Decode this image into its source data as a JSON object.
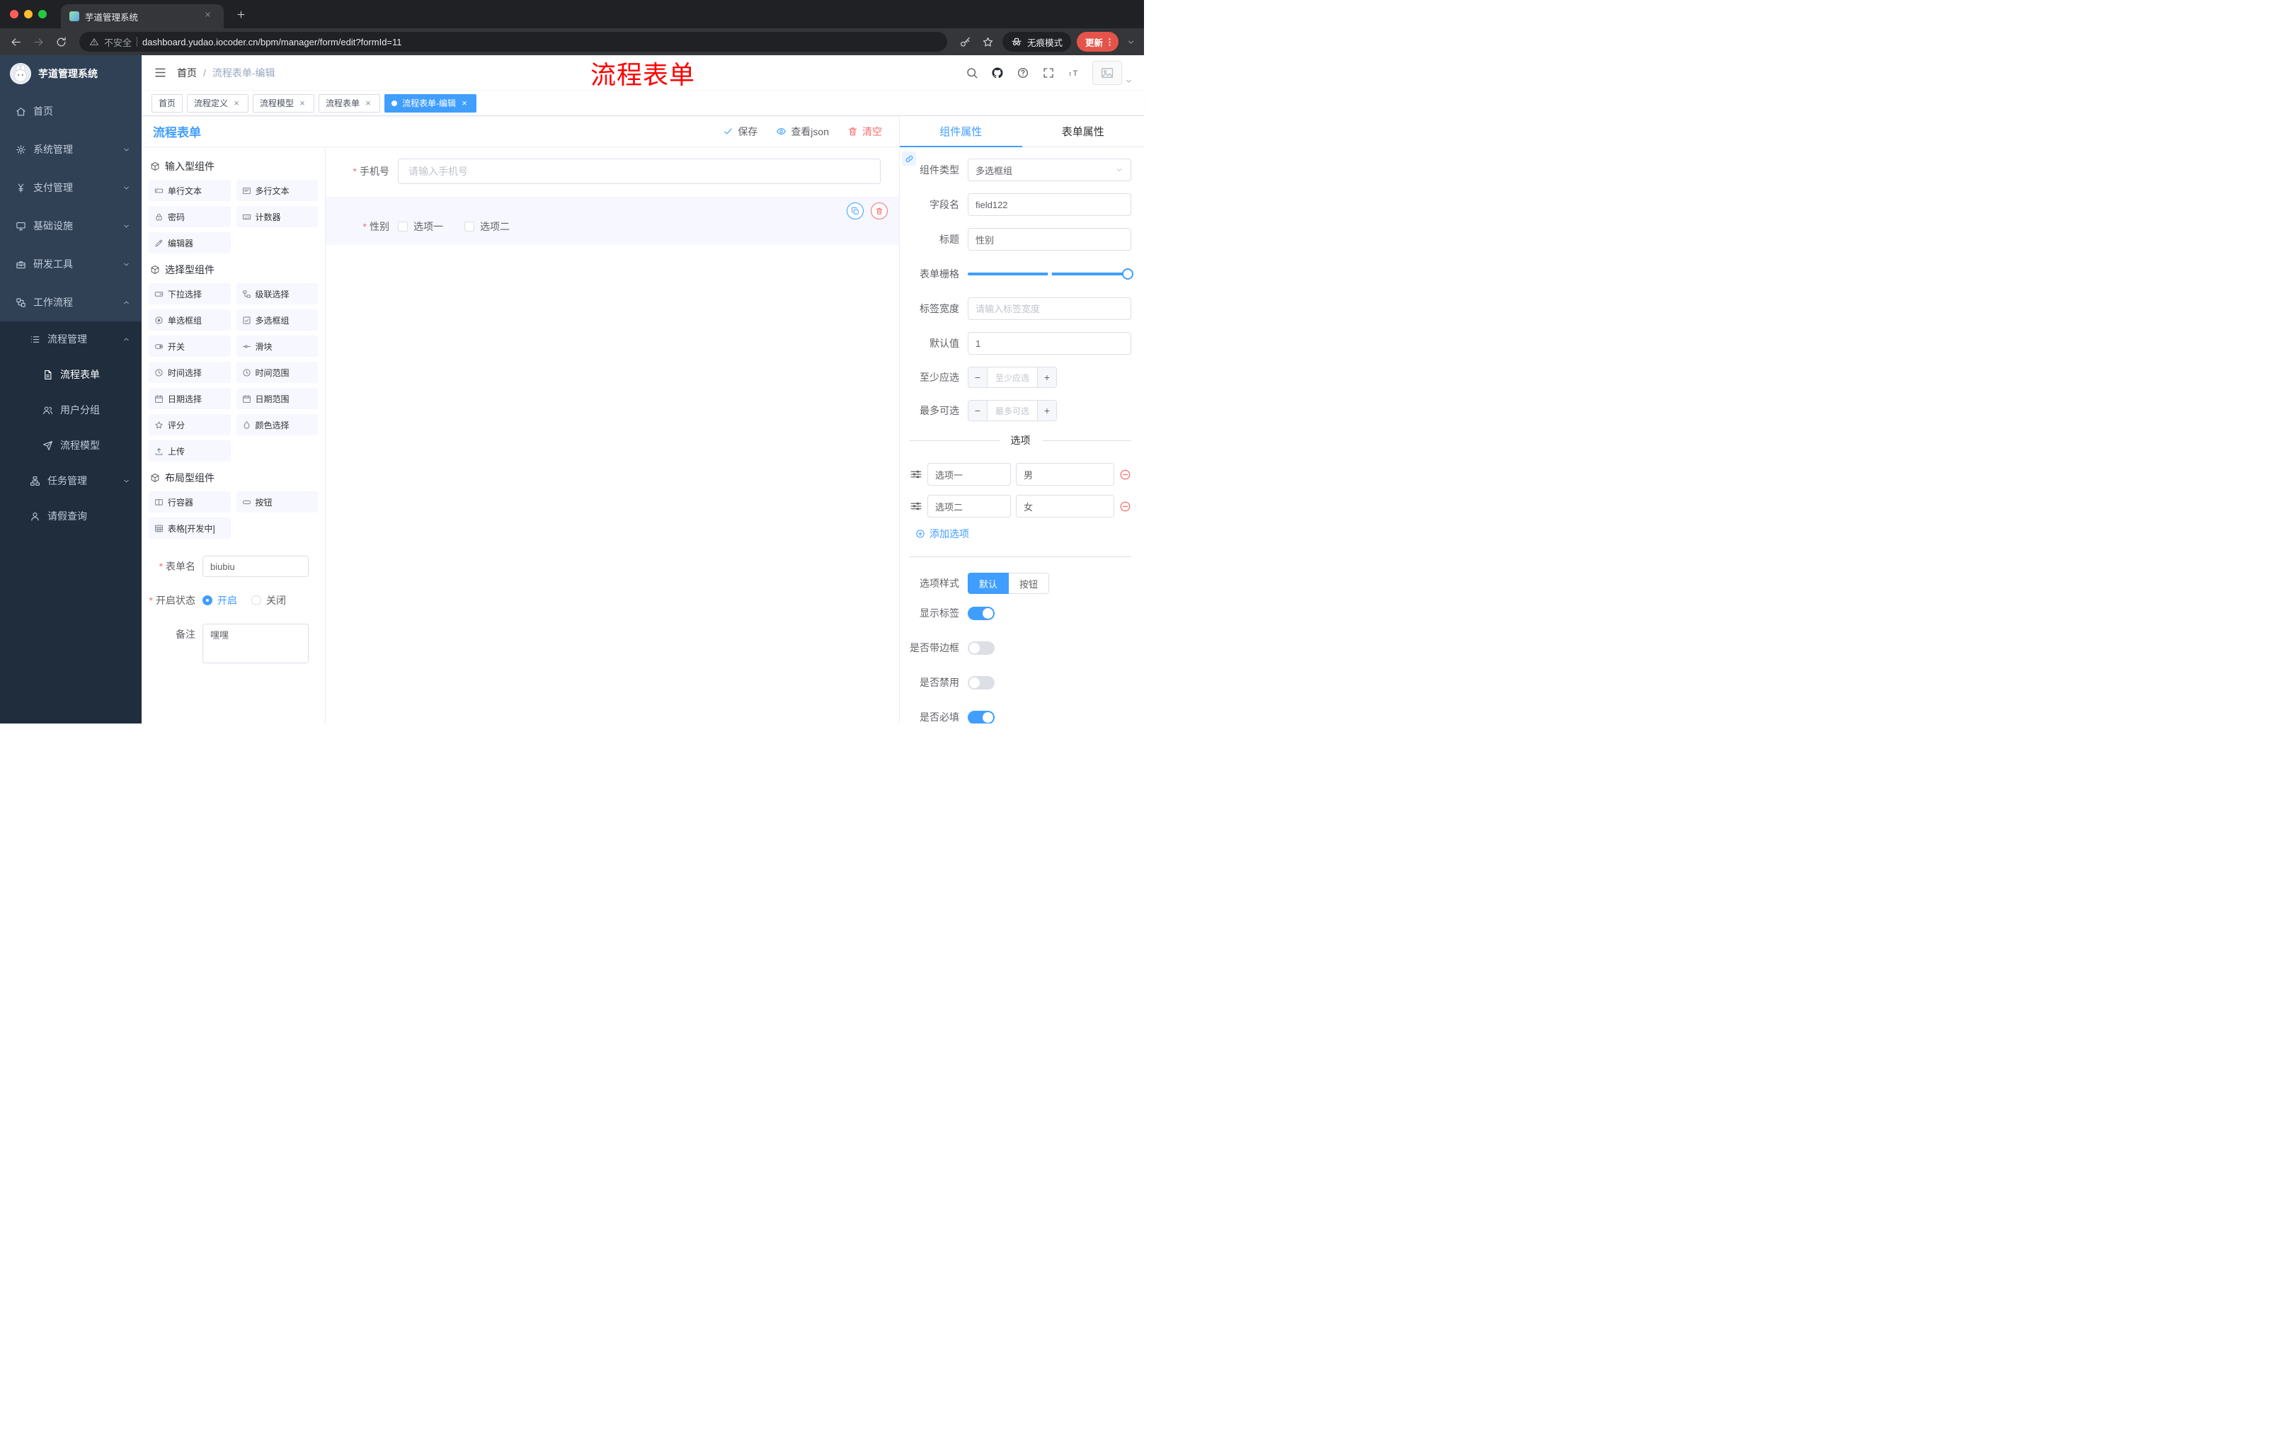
{
  "colors": {
    "primary": "#409eff",
    "danger": "#f56c6c",
    "annotation_red": "#ff0000",
    "sidebar_bg": "#304156",
    "sidebar_submenu_bg": "#1f2d3d",
    "active_tag": "#409eff",
    "update_pill": "#e5544b",
    "selected_field_bg": "#f6f7ff"
  },
  "browser": {
    "tab_title": "芋道管理系统",
    "security": "不安全",
    "url": "dashboard.yudao.iocoder.cn/bpm/manager/form/edit?formId=11",
    "incognito": "无痕模式",
    "update": "更新"
  },
  "sidebar": {
    "logo": "芋道管理系统",
    "menu": [
      "首页",
      "系统管理",
      "支付管理",
      "基础设施",
      "研发工具",
      "工作流程",
      "流程管理",
      "流程表单",
      "用户分组",
      "流程模型",
      "任务管理",
      "请假查询"
    ]
  },
  "header": {
    "breadcrumb_home": "首页",
    "breadcrumb_separator": "/",
    "breadcrumb_current": "流程表单-编辑",
    "annotation": "流程表单"
  },
  "tags": [
    "首页",
    "流程定义",
    "流程模型",
    "流程表单",
    "流程表单-编辑"
  ],
  "designer": {
    "title": "流程表单",
    "actions": {
      "save": "保存",
      "view_json": "查看json",
      "clear": "清空"
    },
    "groups": [
      {
        "title": "输入型组件",
        "items": [
          "单行文本",
          "多行文本",
          "密码",
          "计数器",
          "编辑器"
        ]
      },
      {
        "title": "选择型组件",
        "items": [
          "下拉选择",
          "级联选择",
          "单选框组",
          "多选框组",
          "开关",
          "滑块",
          "时间选择",
          "时间范围",
          "日期选择",
          "日期范围",
          "评分",
          "颜色选择",
          "上传"
        ]
      },
      {
        "title": "布局型组件",
        "items": [
          "行容器",
          "按钮",
          "表格[开发中]"
        ]
      }
    ],
    "meta": {
      "form_name_label": "表单名",
      "form_name_value": "biubiu",
      "status_label": "开启状态",
      "status_on": "开启",
      "status_off": "关闭",
      "remark_label": "备注",
      "remark_value": "嘿嘿"
    },
    "canvas": {
      "phone_label": "手机号",
      "phone_placeholder": "请输入手机号",
      "gender_label": "性别",
      "gender_opt1": "选项一",
      "gender_opt2": "选项二"
    }
  },
  "props": {
    "tab_component": "组件属性",
    "tab_form": "表单属性",
    "component_type_label": "组件类型",
    "component_type_value": "多选框组",
    "field_name_label": "字段名",
    "field_name_value": "field122",
    "title_label": "标题",
    "title_value": "性别",
    "grid_label": "表单栅格",
    "label_width_label": "标签宽度",
    "label_width_placeholder": "请输入标签宽度",
    "default_label": "默认值",
    "default_value": "1",
    "min_label": "至少应选",
    "min_placeholder": "至少应选",
    "max_label": "最多可选",
    "max_placeholder": "最多可选",
    "options_title": "选项",
    "options": [
      {
        "label": "选项一",
        "value": "男"
      },
      {
        "label": "选项二",
        "value": "女"
      }
    ],
    "add_option": "添加选项",
    "style_label": "选项样式",
    "style_default": "默认",
    "style_button": "按钮",
    "show_label": "显示标签",
    "border_label": "是否带边框",
    "disabled_label": "是否禁用",
    "required_label": "是否必填"
  },
  "icons": {
    "header": [
      "search-icon",
      "github-icon",
      "question-icon",
      "fullscreen-icon",
      "font-size-icon",
      "avatar-image",
      "caret-down-icon"
    ],
    "designer_actions": [
      "check-icon",
      "eye-icon",
      "trash-icon"
    ],
    "canvas_item_actions": [
      "copy-icon",
      "delete-icon"
    ],
    "props": [
      "link-icon",
      "drag-icon",
      "minus-circle-icon",
      "plus-circle-icon",
      "chevron-down-icon"
    ]
  }
}
